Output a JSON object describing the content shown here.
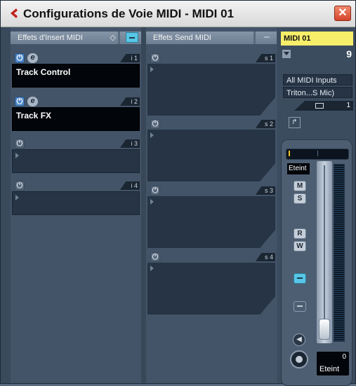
{
  "window": {
    "title": "Configurations de Voie MIDI - MIDI 01",
    "close_icon": "close-icon",
    "app_icon": "cubase-logo-icon"
  },
  "insert": {
    "header": "Effets d'Insert MIDI",
    "slots": [
      {
        "num": "i 1",
        "name": "Track Control",
        "on": true,
        "loaded": true
      },
      {
        "num": "i 2",
        "name": "Track FX",
        "on": true,
        "loaded": true
      },
      {
        "num": "i 3",
        "name": "",
        "on": false,
        "loaded": false
      },
      {
        "num": "i 4",
        "name": "",
        "on": false,
        "loaded": false
      }
    ]
  },
  "send": {
    "header": "Effets Send MIDI",
    "slots": [
      {
        "num": "s 1"
      },
      {
        "num": "s 2"
      },
      {
        "num": "s 3"
      },
      {
        "num": "s 4"
      }
    ]
  },
  "channel": {
    "name": "MIDI 01",
    "program": "9",
    "input": "All MIDI Inputs",
    "output": "Triton...S Mic)",
    "midi_channel": "1",
    "state_label": "Eteint",
    "mute": "M",
    "solo": "S",
    "read": "R",
    "write": "W",
    "volume_value": "0",
    "volume_label": "Eteint",
    "accent": "#58c6e6",
    "name_bg": "#f7ee6a"
  }
}
